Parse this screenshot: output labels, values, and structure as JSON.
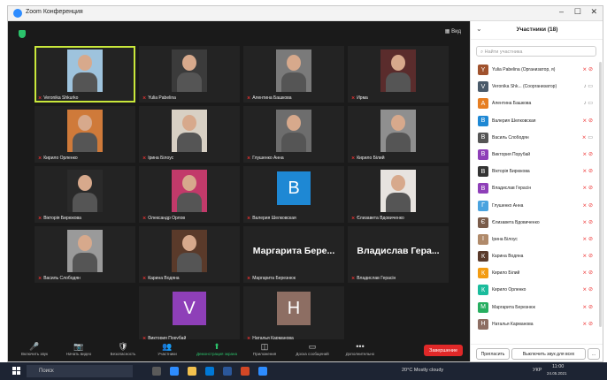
{
  "window": {
    "title": "Zoom Конференция"
  },
  "view_label": "Вид",
  "tiles": [
    {
      "name": "Veronika Shkurko",
      "type": "photo",
      "bg": "#9ec3dd",
      "speaking": true
    },
    {
      "name": "Yulia Pabelina",
      "type": "photo",
      "bg": "#3b3b3b"
    },
    {
      "name": "Алентина Башкова",
      "type": "photo",
      "bg": "#7a7a7a"
    },
    {
      "name": "Ирма",
      "type": "photo",
      "bg": "#5a2c2c"
    },
    {
      "name": "Кирило Орленко",
      "type": "photo",
      "bg": "#cf7a3a"
    },
    {
      "name": "Ірина Білоус",
      "type": "photo",
      "bg": "#d8d0c4"
    },
    {
      "name": "Глушенко Анна",
      "type": "photo",
      "bg": "#6d6d6d"
    },
    {
      "name": "Кирило Білий",
      "type": "photo",
      "bg": "#8f8f8f"
    },
    {
      "name": "Вікторія Бирюкова",
      "type": "photo",
      "bg": "#2a2a2a"
    },
    {
      "name": "Олександр Орлов",
      "type": "photo",
      "bg": "#c23a6a"
    },
    {
      "name": "Валерия Шелковская",
      "type": "avatar",
      "letter": "B",
      "color": "#1e88d4"
    },
    {
      "name": "Єлизавета Вдовиченко",
      "type": "photo",
      "bg": "#e7e3df"
    },
    {
      "name": "Василь Слободян",
      "type": "photo",
      "bg": "#9a9a9a"
    },
    {
      "name": "Карина Водяна",
      "type": "photo",
      "bg": "#5a3a2a"
    },
    {
      "name": "Маргарита Березнюк",
      "type": "bigname",
      "display": "Маргарита Бере..."
    },
    {
      "name": "Владислав Герасін",
      "type": "bigname",
      "display": "Владислав Гера..."
    },
    {
      "name": "Виктория Порубай",
      "type": "avatar",
      "letter": "V",
      "color": "#8e3fb8"
    },
    {
      "name": "Наталья Карманова",
      "type": "avatar",
      "letter": "H",
      "color": "#8d6e63"
    }
  ],
  "toolbar": [
    {
      "label": "Включить звук",
      "icon": "🎤"
    },
    {
      "label": "Начать видео",
      "icon": "📷"
    },
    {
      "label": "Безопасность",
      "icon": "🛡"
    },
    {
      "label": "Участники",
      "icon": "👥"
    },
    {
      "label": "Демонстрация экрана",
      "icon": "⬆"
    },
    {
      "label": "Приложения",
      "icon": "◫"
    },
    {
      "label": "Доска сообщений",
      "icon": "▭"
    },
    {
      "label": "Дополнительно",
      "icon": "•••"
    }
  ],
  "end_label": "Завершение",
  "panel": {
    "title": "Участники (18)",
    "search_placeholder": "Найти участника",
    "participants": [
      {
        "name": "Yulia Pabelina (Организатор, я)",
        "color": "#a0522d",
        "muted": true,
        "video_off": true
      },
      {
        "name": "Veronika Shk... (Соорганизатор)",
        "color": "#4a5a6a",
        "muted": false,
        "video_off": false
      },
      {
        "name": "Алентина Башкова",
        "color": "#e67e22",
        "muted": false,
        "video_off": false
      },
      {
        "name": "Валерия Шелковская",
        "color": "#1e88d4",
        "muted": true,
        "video_off": true
      },
      {
        "name": "Василь Слободян",
        "color": "#555555",
        "muted": true,
        "video_off": false
      },
      {
        "name": "Виктория Порубай",
        "color": "#8e3fb8",
        "muted": true,
        "video_off": true
      },
      {
        "name": "Вікторія Бирюкова",
        "color": "#333333",
        "muted": true,
        "video_off": true
      },
      {
        "name": "Владислав Герасін",
        "color": "#8e3fb8",
        "muted": true,
        "video_off": true
      },
      {
        "name": "Глушенко Анна",
        "color": "#4aa3df",
        "muted": true,
        "video_off": true
      },
      {
        "name": "Єлизавета Вдовиченко",
        "color": "#7a5c4a",
        "muted": true,
        "video_off": true
      },
      {
        "name": "Ірина Білоус",
        "color": "#b08a6a",
        "muted": true,
        "video_off": true
      },
      {
        "name": "Карина Водяна",
        "color": "#5a3a2a",
        "muted": true,
        "video_off": true
      },
      {
        "name": "Кирило Білий",
        "color": "#f39c12",
        "muted": true,
        "video_off": true
      },
      {
        "name": "Кирило Орленко",
        "color": "#1abc9c",
        "muted": true,
        "video_off": true
      },
      {
        "name": "Маргарита Березнюк",
        "color": "#27ae60",
        "muted": true,
        "video_off": true
      },
      {
        "name": "Наталья Карманова",
        "color": "#8d6e63",
        "muted": true,
        "video_off": true
      }
    ],
    "invite_label": "Пригласить",
    "mute_all_label": "Выключить звук для всех",
    "more_label": "..."
  },
  "taskbar": {
    "search_placeholder": "Поиск",
    "weather": "20°C  Mostly cloudy",
    "lang": "УКР",
    "time": "11:00",
    "date": "24.05.2021"
  }
}
